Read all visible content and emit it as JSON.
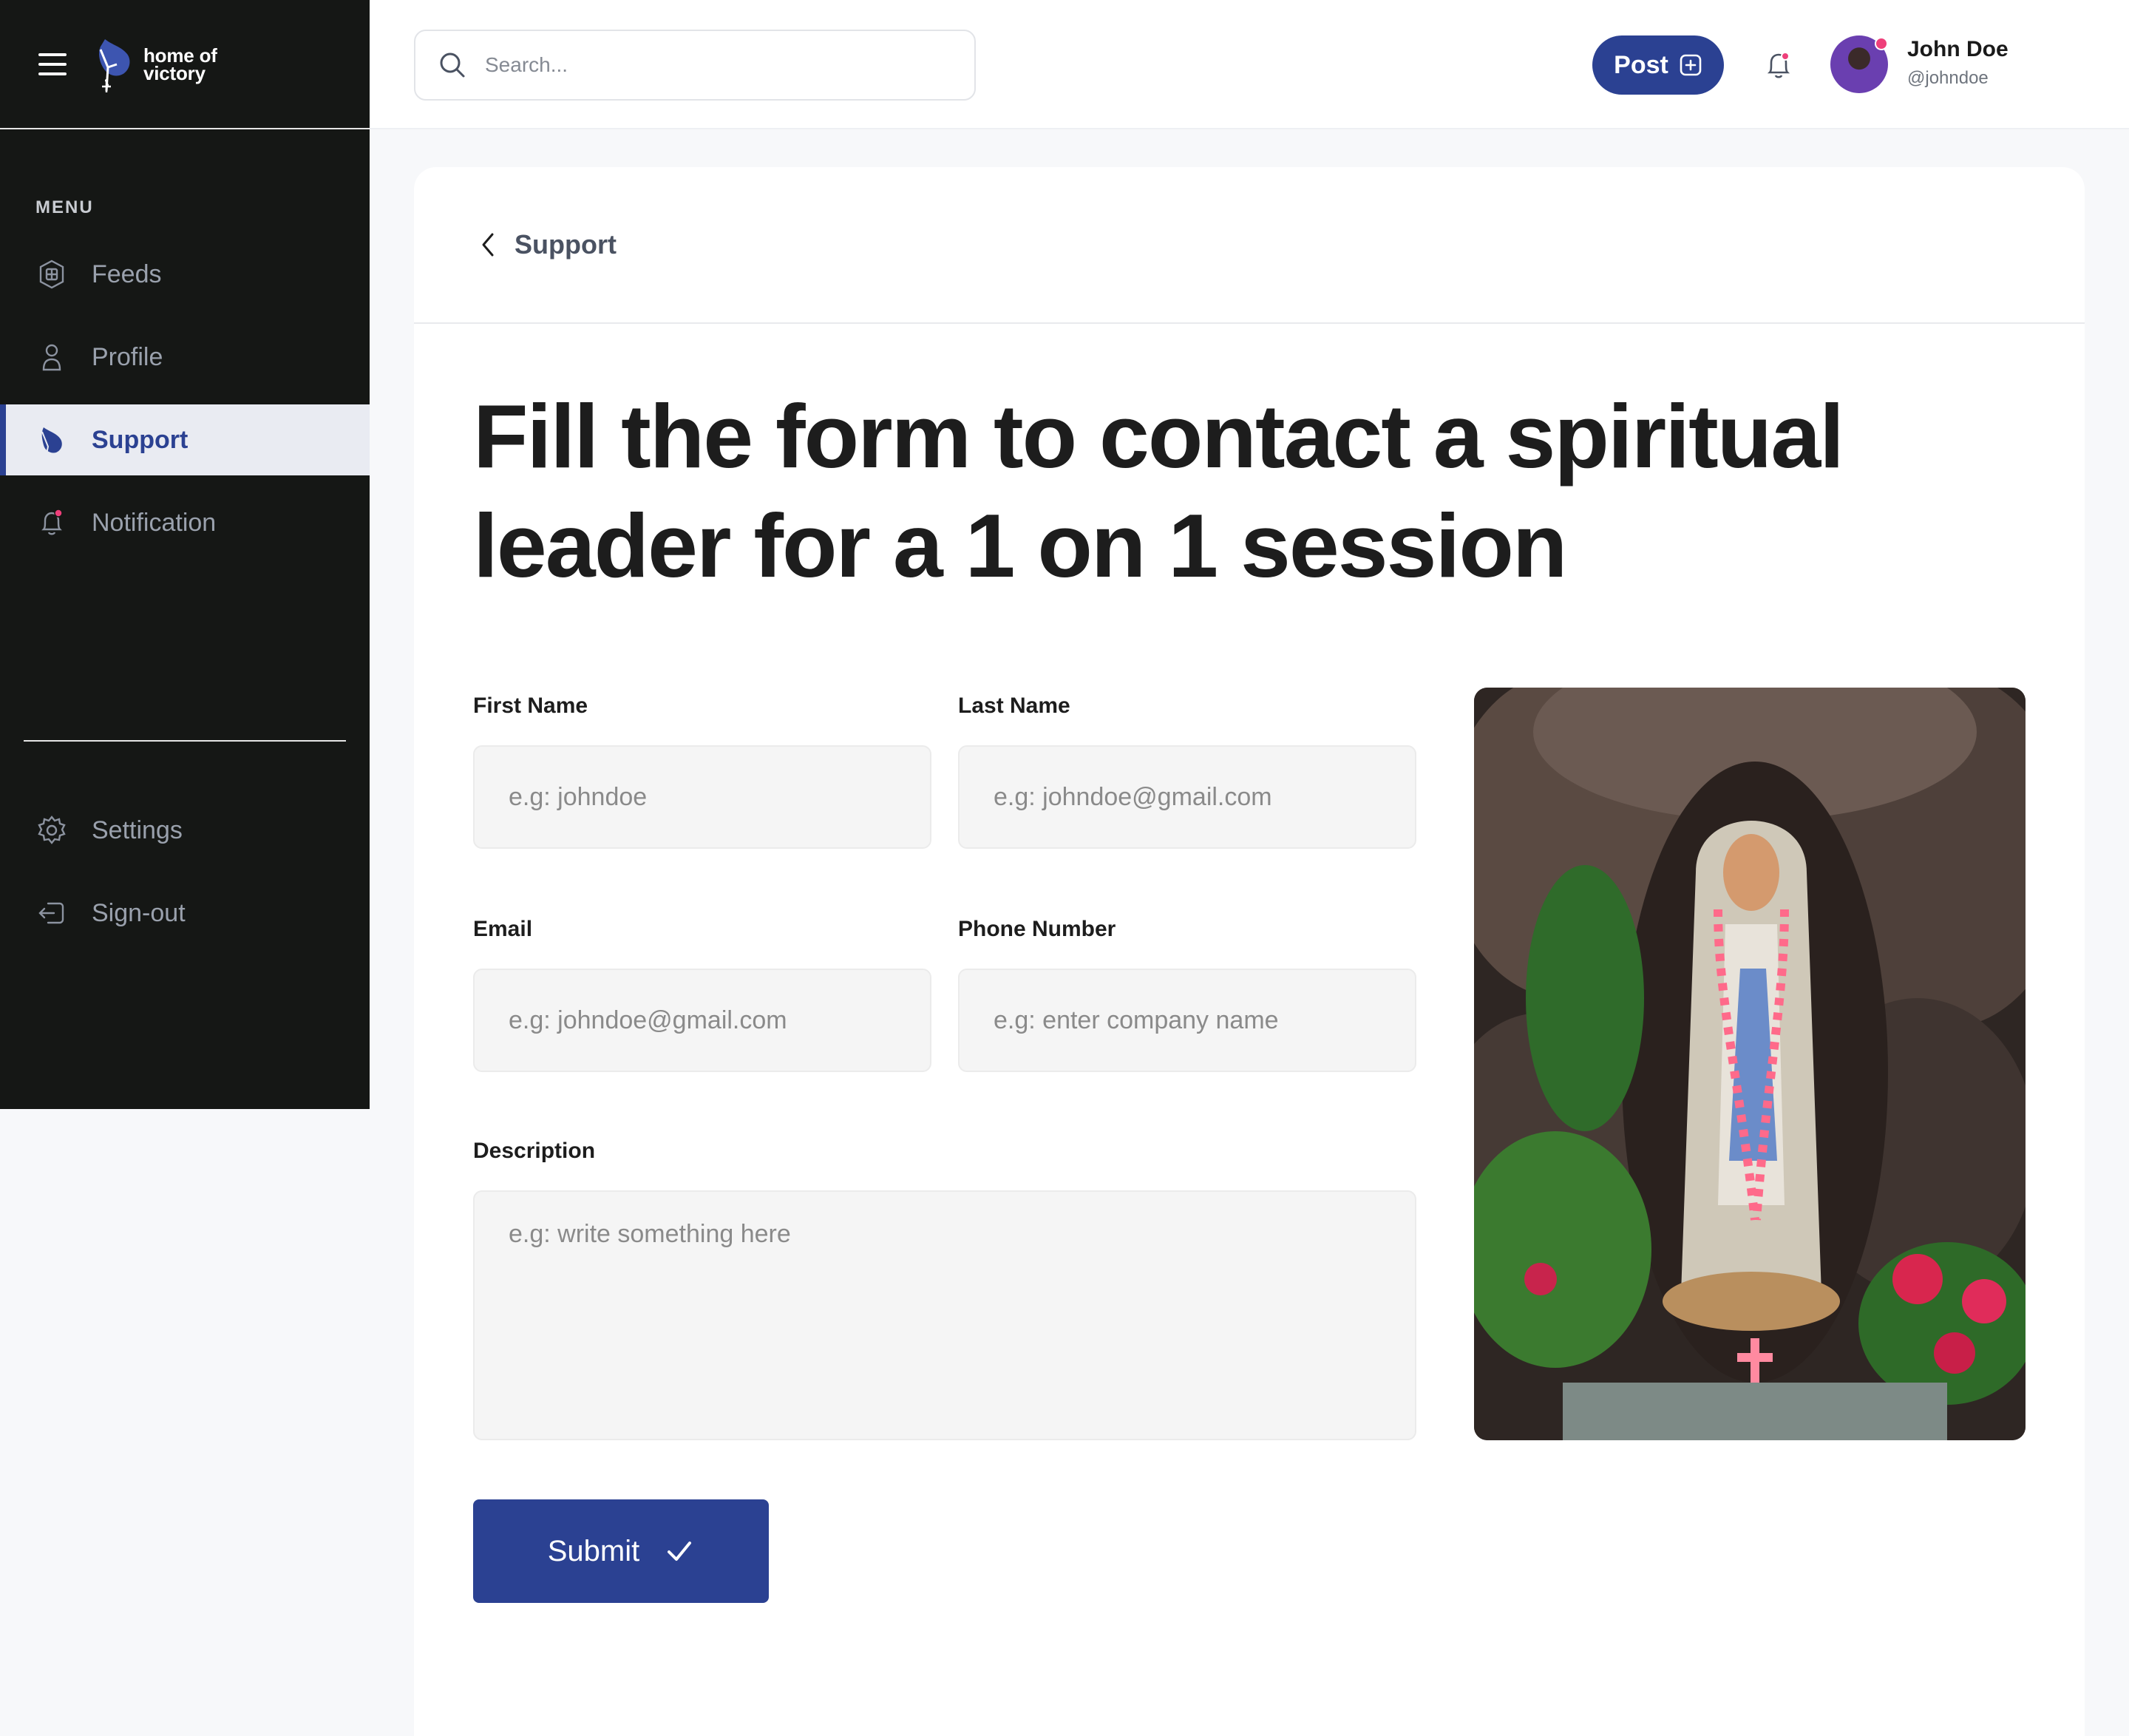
{
  "brand": {
    "line1": "home of",
    "line2": "victory"
  },
  "sidebar": {
    "menu_label": "MENU",
    "items": [
      {
        "label": "Feeds",
        "icon": "feeds-icon",
        "active": false
      },
      {
        "label": "Profile",
        "icon": "profile-icon",
        "active": false
      },
      {
        "label": "Support",
        "icon": "support-icon",
        "active": true
      },
      {
        "label": "Notification",
        "icon": "notification-icon",
        "active": false
      }
    ],
    "bottom_items": [
      {
        "label": "Settings",
        "icon": "settings-icon"
      },
      {
        "label": "Sign-out",
        "icon": "sign-out-icon"
      }
    ]
  },
  "header": {
    "search_placeholder": "Search...",
    "post_label": "Post",
    "user": {
      "name": "John Doe",
      "handle": "@johndoe"
    }
  },
  "page": {
    "back_label": "Support",
    "title": "Fill the form to contact a spiritual leader for a 1 on 1 session"
  },
  "form": {
    "first_name": {
      "label": "First Name",
      "placeholder": "e.g: johndoe"
    },
    "last_name": {
      "label": "Last Name",
      "placeholder": "e.g: johndoe@gmail.com"
    },
    "email": {
      "label": "Email",
      "placeholder": "e.g: johndoe@gmail.com"
    },
    "phone": {
      "label": "Phone Number",
      "placeholder": "e.g: enter company name"
    },
    "description": {
      "label": "Description",
      "placeholder": "e.g: write something here"
    },
    "submit_label": "Submit"
  },
  "colors": {
    "brand_blue": "#2b4192",
    "sidebar_bg": "#151715",
    "notification_dot": "#ee3f7a"
  }
}
